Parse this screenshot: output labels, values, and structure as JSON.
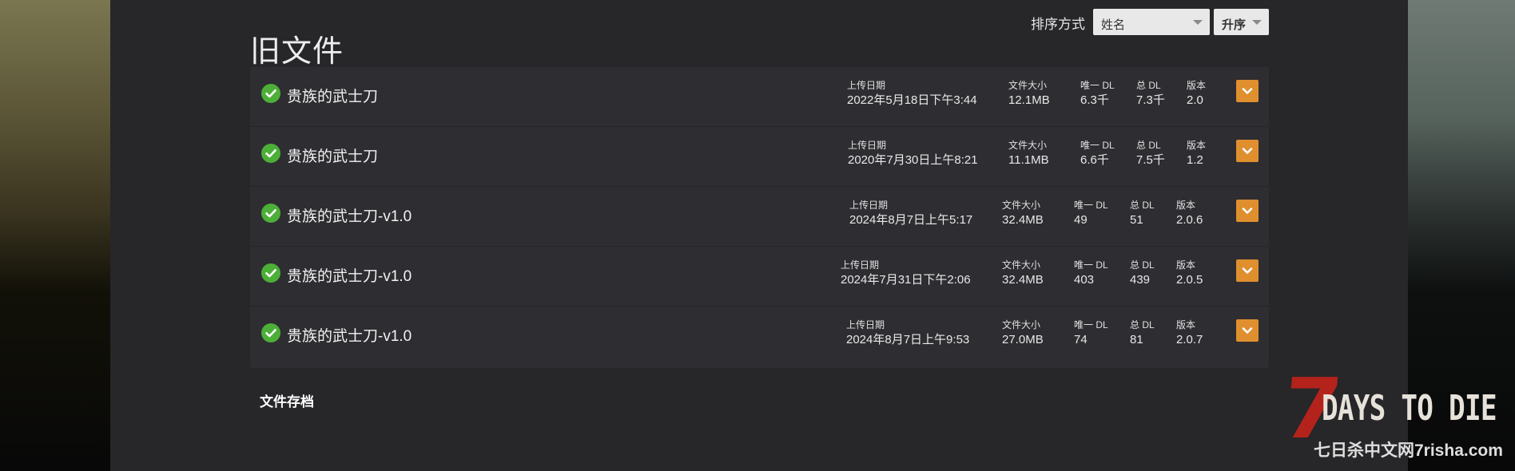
{
  "header": {
    "title": "旧文件",
    "sort_label": "排序方式",
    "sort_by": "姓名",
    "sort_order": "升序"
  },
  "labels": {
    "upload_date": "上传日期",
    "file_size": "文件大小",
    "unique_dl": "唯一 DL",
    "total_dl": "总 DL",
    "version": "版本"
  },
  "files": [
    {
      "name": "贵族的武士刀",
      "date": "2022年5月18日下午3:44",
      "size": "12.1MB",
      "unique_dl": "6.3千",
      "total_dl": "7.3千",
      "version": "2.0"
    },
    {
      "name": "贵族的武士刀",
      "date": "2020年7月30日上午8:21",
      "size": "11.1MB",
      "unique_dl": "6.6千",
      "total_dl": "7.5千",
      "version": "1.2"
    },
    {
      "name": "贵族的武士刀-v1.0",
      "date": "2024年8月7日上午5:17",
      "size": "32.4MB",
      "unique_dl": "49",
      "total_dl": "51",
      "version": "2.0.6"
    },
    {
      "name": "贵族的武士刀-v1.0",
      "date": "2024年7月31日下午2:06",
      "size": "32.4MB",
      "unique_dl": "403",
      "total_dl": "439",
      "version": "2.0.5"
    },
    {
      "name": "贵族的武士刀-v1.0",
      "date": "2024年8月7日上午9:53",
      "size": "27.0MB",
      "unique_dl": "74",
      "total_dl": "81",
      "version": "2.0.7"
    }
  ],
  "footer": {
    "archive_link": "文件存档"
  },
  "watermark": {
    "numeral": "7",
    "title": "DAYS TO DIE",
    "subtitle": "七日杀中文网7risha.com"
  },
  "colors": {
    "accent": "#e08f2f",
    "success": "#4caf38",
    "logo_red": "#b3231b"
  }
}
